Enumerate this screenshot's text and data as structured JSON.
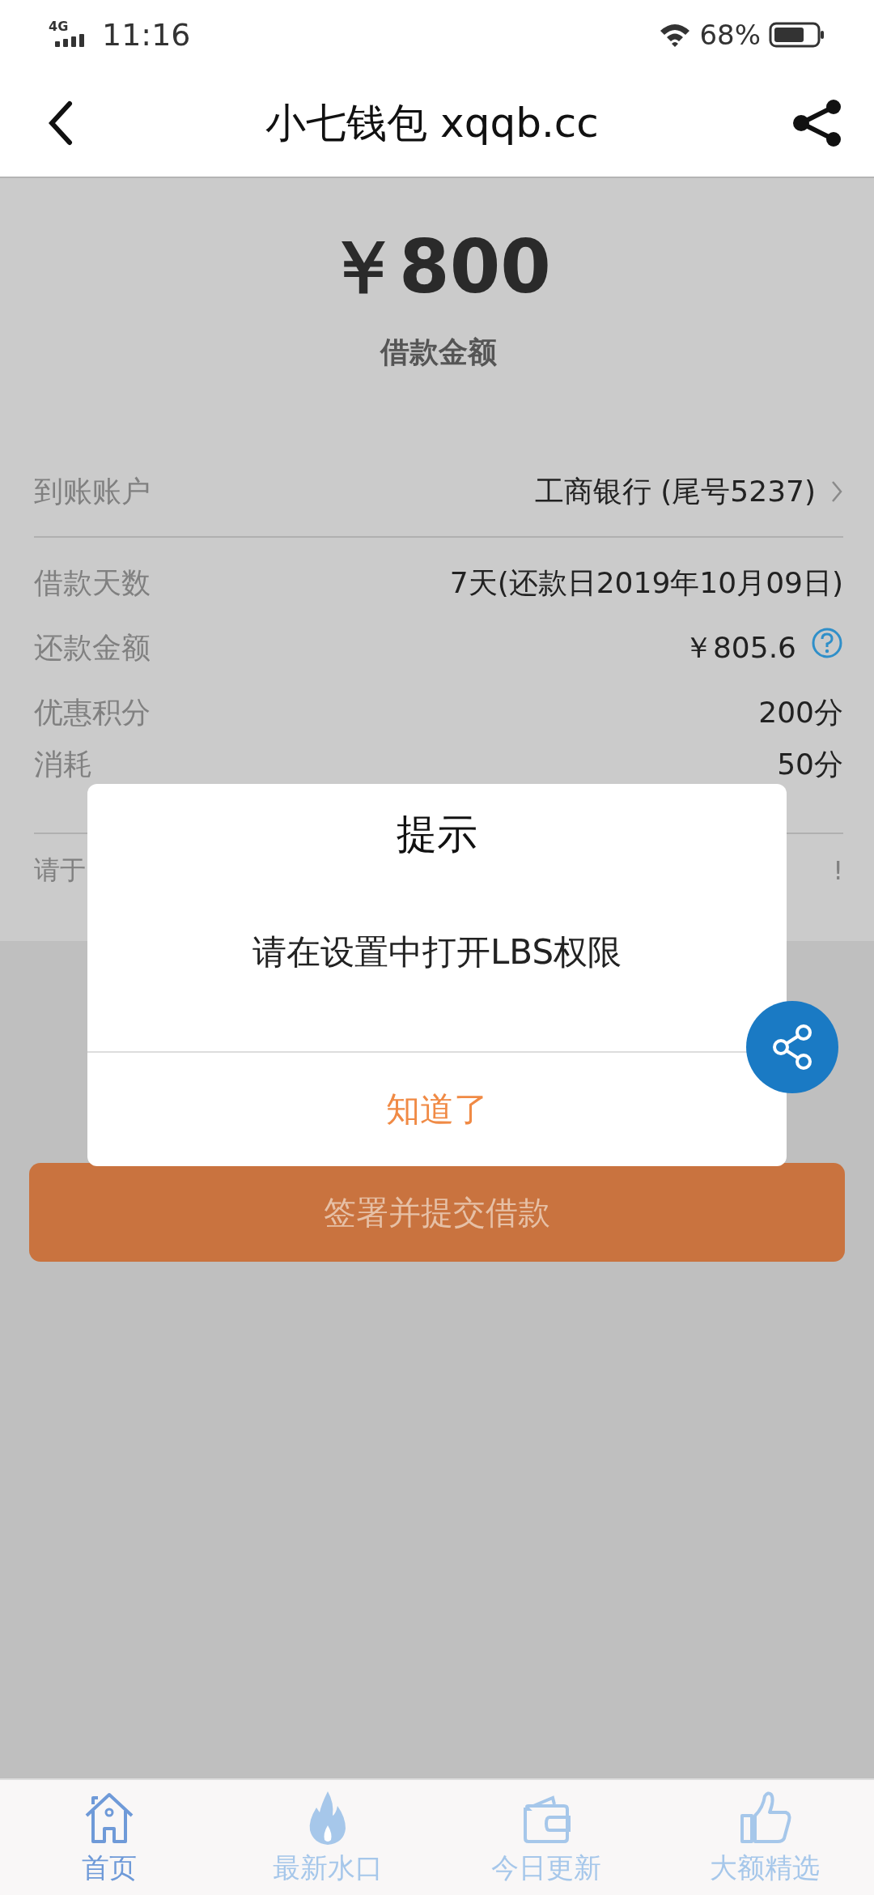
{
  "status_bar": {
    "network": "4G",
    "time": "11:16",
    "battery": "68%"
  },
  "header": {
    "title": "小七钱包 xqqb.cc"
  },
  "loan": {
    "amount": "￥800",
    "amount_label": "借款金额"
  },
  "account": {
    "label": "到账账户",
    "value": "工商银行 (尾号5237)"
  },
  "details": [
    {
      "label": "借款天数",
      "value": "7天(还款日2019年10月09日)",
      "kind": "plain"
    },
    {
      "label": "还款金额",
      "value": "￥805.6",
      "kind": "help"
    },
    {
      "label": "优惠积分",
      "value": "200分",
      "kind": "plain"
    },
    {
      "label": "消耗",
      "value": "50分",
      "kind": "plain"
    }
  ],
  "note": {
    "left": "请于",
    "right": "!"
  },
  "submit_button": "签署并提交借款",
  "dialog": {
    "title": "提示",
    "message": "请在设置中打开LBS权限",
    "button": "知道了"
  },
  "tabs": [
    {
      "label": "首页",
      "kind": "home",
      "selected": true
    },
    {
      "label": "最新水口",
      "kind": "flame",
      "selected": false
    },
    {
      "label": "今日更新",
      "kind": "wallet",
      "selected": false
    },
    {
      "label": "大额精选",
      "kind": "thumb",
      "selected": false
    }
  ]
}
